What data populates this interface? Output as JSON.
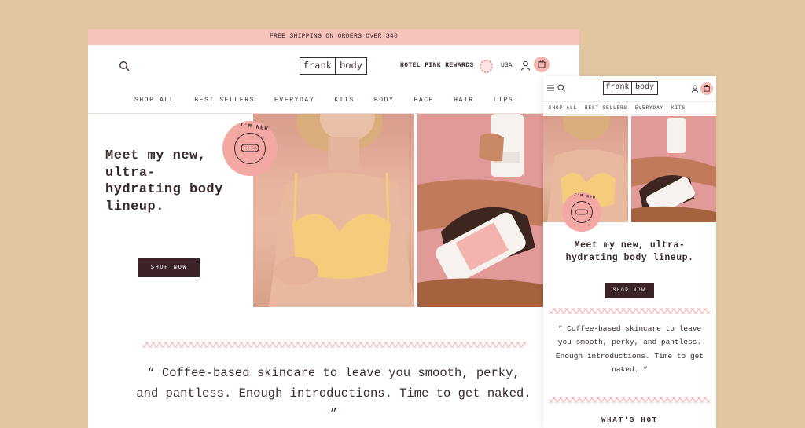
{
  "desktop": {
    "banner": "FREE SHIPPING ON ORDERS OVER $40",
    "logo": {
      "left": "frank",
      "right": "body"
    },
    "rewards": "HOTEL PINK REWARDS",
    "region": "USA",
    "nav": [
      "SHOP ALL",
      "BEST SELLERS",
      "EVERYDAY",
      "KITS",
      "BODY",
      "FACE",
      "HAIR",
      "LIPS"
    ],
    "hero_title": "Meet my new, ultra-hydrating body lineup.",
    "shop_now": "SHOP NOW",
    "sticker_text": "I'M NEW",
    "quote": "“ Coffee-based skincare to leave you smooth, perky, and pantless. Enough introductions. Time to get naked. ”"
  },
  "mobile": {
    "logo": {
      "left": "frank",
      "right": "body"
    },
    "nav": [
      "SHOP ALL",
      "BEST SELLERS",
      "EVERYDAY",
      "KITS"
    ],
    "hero_title": "Meet my new, ultra-hydrating body lineup.",
    "shop_now": "SHOP NOW",
    "sticker_text": "I'M NEW",
    "quote": "“ Coffee-based skincare to leave you smooth, perky, and pantless. Enough introductions. Time to get naked. ”",
    "section_title": "WHAT'S HOT"
  },
  "colors": {
    "background": "#e2c6a0",
    "banner": "#f7c3bd",
    "button": "#3b2328",
    "accent_pink": "#f3a8a4",
    "text": "#3a2a2a"
  },
  "icons": [
    "search-icon",
    "user-icon",
    "cart-icon",
    "menu-icon",
    "rewards-badge-icon"
  ]
}
